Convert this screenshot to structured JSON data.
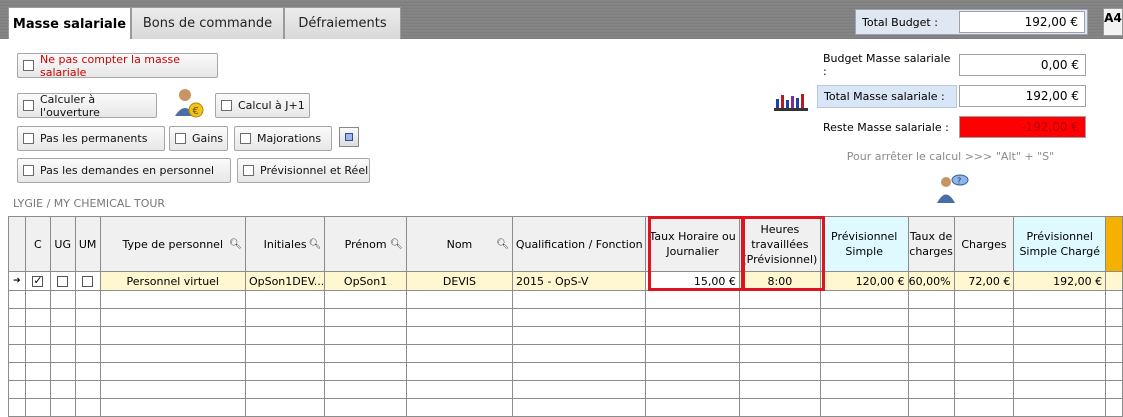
{
  "tabs": [
    {
      "label": "Masse salariale"
    },
    {
      "label": "Bons de commande"
    },
    {
      "label": "Défraiements"
    }
  ],
  "budget": {
    "total_label": "Total Budget :",
    "total_value": "192,00 €",
    "masse_label": "Budget Masse salariale :",
    "masse_value": "0,00 €",
    "total_masse_label": "Total Masse salariale :",
    "total_masse_value": "192,00 €",
    "reste_label": "Reste Masse salariale :",
    "reste_value": "-192,00 €",
    "reste_color": "#ff0000",
    "hint": "Pour arrêter le calcul >>> \"Alt\" + \"S\""
  },
  "options": {
    "ne_pas_compter": "Ne pas compter la masse salariale",
    "calculer_ouverture": "Calculer à l'ouverture",
    "calcul_j1": "Calcul à J+1",
    "pas_permanents": "Pas les permanents",
    "gains": "Gains",
    "majorations": "Majorations",
    "pas_demandes": "Pas les demandes en personnel",
    "previsionnel_reel": "Prévisionnel et Réel"
  },
  "breadcrumb": "LYGIE / MY CHEMICAL TOUR",
  "corner_badge": "A4",
  "grid": {
    "headers": {
      "c": "C",
      "ug": "UG",
      "um": "UM",
      "type": "Type de personnel",
      "initiales": "Initiales",
      "prenom": "Prénom",
      "nom": "Nom",
      "qualification": "Qualification / Fonction",
      "taux": "Taux Horaire ou Journalier",
      "heures": "Heures travaillées (Prévisionnel)",
      "prev_simple": "Prévisionnel Simple",
      "taux_charges": "Taux de charges",
      "charges": "Charges",
      "prev_charge": "Prévisionnel Simple Chargé"
    },
    "row": {
      "c_checked": true,
      "ug_checked": false,
      "um_checked": false,
      "type": "Personnel virtuel",
      "initiales": "OpSon1DEV...",
      "prenom": "OpSon1",
      "nom": "DEVIS",
      "qualification": "2015 - OpS-V",
      "taux": "15,00 €",
      "heures": "8:00",
      "prev_simple": "120,00 €",
      "taux_charges": "60,00%",
      "charges": "72,00 €",
      "prev_charge": "192,00 €"
    },
    "empty_rows": 7
  }
}
